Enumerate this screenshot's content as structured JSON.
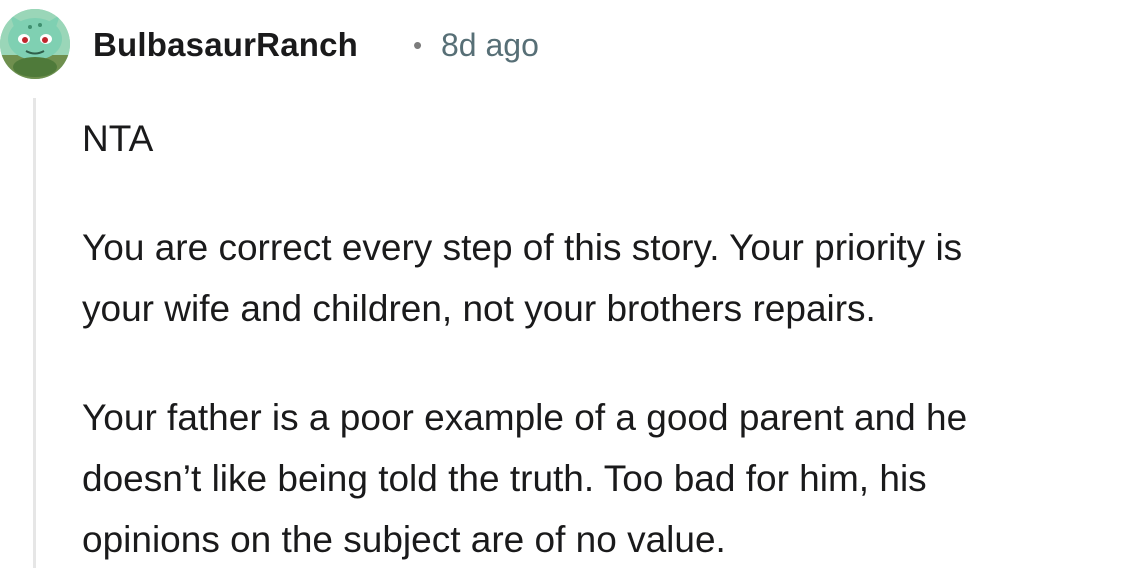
{
  "comment": {
    "author": "BulbasaurRanch",
    "separator": "•",
    "timestamp": "8d ago",
    "avatar_icon": "bulbasaur-avatar-icon",
    "paragraphs": [
      "NTA",
      "You are correct every step of this story. Your priority is\nyour wife and children, not your brothers repairs.",
      "Your father is a poor example of a good parent and he\ndoesn’t like being told the truth. Too bad for him, his\nopinions on the subject are of no value."
    ]
  },
  "colors": {
    "username": "#1a1a1b",
    "timestamp": "#576f76",
    "thread_line": "#e6e6e6",
    "avatar_bg": "#8ecfae"
  }
}
